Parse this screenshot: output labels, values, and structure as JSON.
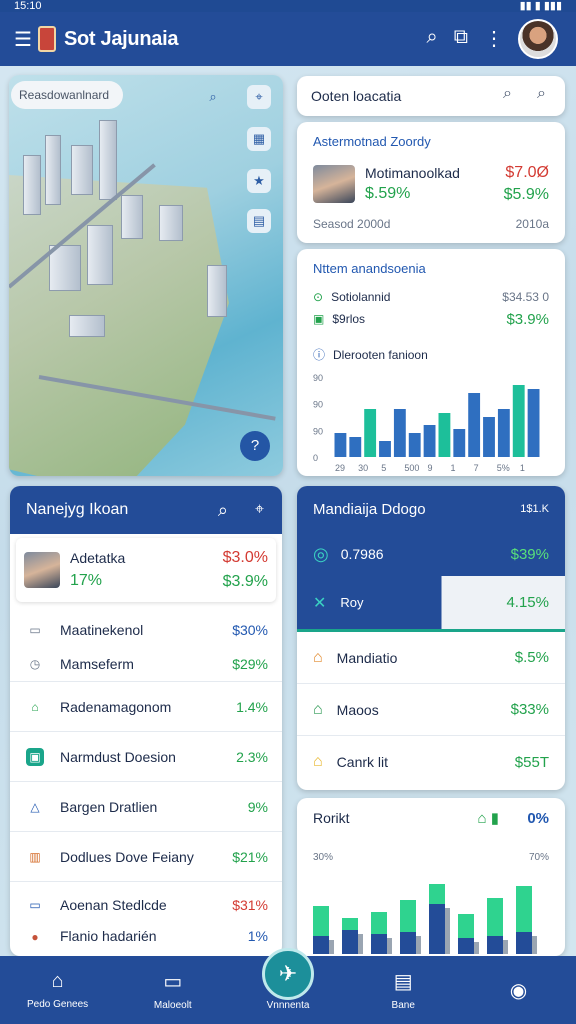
{
  "status": {
    "time": "15:10",
    "right": "▮▮ ▮ ▮▮▮"
  },
  "appbar": {
    "title": "Sot Jajunaia",
    "menu_icon": "☰",
    "search_icon": "⌕",
    "camera_icon": "⧉",
    "more_icon": "⋮"
  },
  "map": {
    "search_label": "Reasdowanlnard",
    "search_icon": "⌕",
    "icons": [
      "⌖",
      "▦",
      "★",
      "▤"
    ],
    "fab": "?"
  },
  "search_card": {
    "label": "Ooten loacatia"
  },
  "alert_card": {
    "title": "Astermotnad Zoordy",
    "name": "Motimanoolkad",
    "price": "$7.0Ø",
    "change": "$.59%",
    "change2": "$5.9%",
    "sub_left": "Seasod 2000d",
    "sub_right": "2010a"
  },
  "chart_card": {
    "title": "Nttem anandsoenia",
    "rows": [
      {
        "label": "Sotiolannid",
        "value": "$34.53 0"
      },
      {
        "label": "$9rlos",
        "value": "$3.9%"
      }
    ],
    "subtitle": "Dlerooten fanioon"
  },
  "chart_data": {
    "type": "bar",
    "categories": [
      "29",
      "30",
      "5",
      "300",
      "9",
      "1",
      "7",
      "5%",
      "1"
    ],
    "yticks": [
      "90",
      "90",
      "90",
      "0"
    ],
    "xticks": [
      "29",
      "30",
      "5",
      "500",
      "9",
      "1",
      "7",
      "5%",
      "1"
    ],
    "series": [
      {
        "values": [
          30,
          25,
          60,
          20,
          60,
          30,
          40,
          55,
          35,
          80,
          50,
          60,
          90,
          85
        ]
      }
    ],
    "ylim": [
      0,
      100
    ]
  },
  "left_panel": {
    "title": "Nanejyg Ikoan",
    "top_item": {
      "name": "Adetatka",
      "pct1": "$3.0%",
      "pct2": "17%",
      "pct3": "$3.9%"
    },
    "items": [
      {
        "label": "Maatinekenol",
        "pct": "$30%",
        "icon": "▭"
      },
      {
        "label": "Mamseferm",
        "pct": "$29%",
        "icon": "◷"
      },
      {
        "label": "Radenamagonom",
        "pct": "1.4%",
        "icon": "⌂"
      },
      {
        "label": "Narmdust Doesion",
        "pct": "2.3%",
        "icon": "▣"
      },
      {
        "label": "Bargen Dratlien",
        "pct": "9%",
        "icon": "△"
      },
      {
        "label": "Dodlues Dove Feiany",
        "pct": "$21%",
        "icon": "▥"
      },
      {
        "label": "Aoenan Stedlcde",
        "pct": "$31%",
        "icon": "▭"
      },
      {
        "label": "Flanio hadarién",
        "pct": "1%",
        "icon": "●"
      }
    ]
  },
  "right_panel": {
    "title": "Mandiaija Ddogo",
    "title_right": "1$1.K",
    "highlight": {
      "label": "0.7986",
      "pct": "$39%"
    },
    "items": [
      {
        "label": "Roy",
        "pct": "4.15%",
        "icon": "✕"
      },
      {
        "label": "Mandiatio",
        "pct": "$.5%",
        "icon": "⌂"
      },
      {
        "label": "Maoos",
        "pct": "$33%",
        "icon": "⌂"
      },
      {
        "label": "Canrk lit",
        "pct": "$55T",
        "icon": "⌂"
      }
    ]
  },
  "bar_card": {
    "title": "Rorikt",
    "pct": "0%",
    "left_tick": "30%",
    "right_tick": "70%"
  },
  "nav": {
    "items": [
      {
        "label": "Pedo Genees",
        "icon": "⌂"
      },
      {
        "label": "Maloeolt",
        "icon": "▭"
      },
      {
        "label": "Vnnnenta",
        "icon": "✈"
      },
      {
        "label": "Bane",
        "icon": "▤"
      },
      {
        "label": "",
        "icon": "◉"
      }
    ]
  }
}
